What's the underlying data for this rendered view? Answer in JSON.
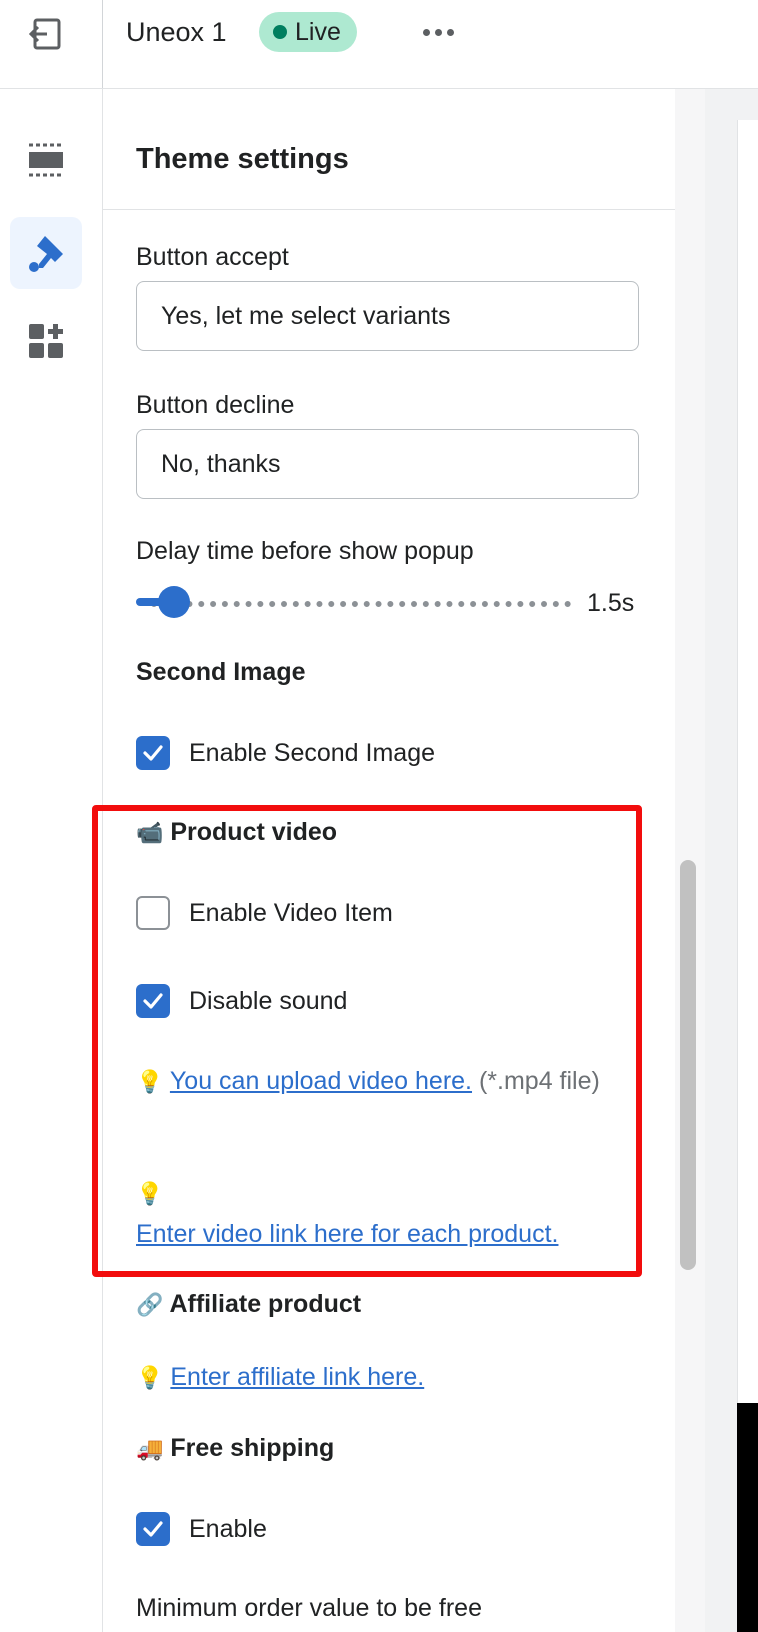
{
  "topbar": {
    "theme_name": "Uneox 1",
    "status_badge": "Live",
    "exit_icon": "exit-icon",
    "more_icon": "more-horizontal-icon"
  },
  "rail": {
    "items": [
      {
        "icon": "sections-icon",
        "active": false
      },
      {
        "icon": "theme-settings-brush-icon",
        "active": true
      },
      {
        "icon": "app-blocks-icon",
        "active": false
      }
    ]
  },
  "panel": {
    "title": "Theme settings",
    "button_accept": {
      "label": "Button accept",
      "value": "Yes, let me select variants"
    },
    "button_decline": {
      "label": "Button decline",
      "value": "No, thanks"
    },
    "delay": {
      "label": "Delay time before show popup",
      "value_text": "1.5s",
      "value": 1.5
    },
    "second_image": {
      "heading": "Second Image",
      "enable_label": "Enable Second Image",
      "enable_checked": true
    },
    "product_video": {
      "emoji": "📹",
      "heading": "Product video",
      "enable_video_label": "Enable Video Item",
      "enable_video_checked": false,
      "disable_sound_label": "Disable sound",
      "disable_sound_checked": true,
      "bulb": "💡",
      "upload_link": "You can upload video here.",
      "upload_note": "(*.mp4 file)",
      "video_link": "Enter video link here for each product."
    },
    "affiliate": {
      "emoji": "🔗",
      "heading": "Affiliate product",
      "bulb": "💡",
      "link": "Enter affiliate link here."
    },
    "free_shipping": {
      "emoji": "🚚",
      "heading": "Free shipping",
      "enable_label": "Enable",
      "enable_checked": true,
      "min_order_label": "Minimum order value to be free"
    }
  },
  "colors": {
    "accent": "#2c6ecb",
    "live_badge": "#aee9d1",
    "live_dot": "#007f5f",
    "highlight": "#f20d0d"
  }
}
